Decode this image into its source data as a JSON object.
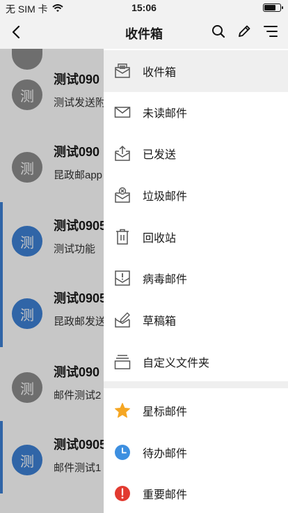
{
  "status_bar": {
    "carrier": "无 SIM 卡",
    "time": "15:06",
    "wifi_icon": "wifi-icon",
    "battery_icon": "battery-icon"
  },
  "nav": {
    "title": "收件箱",
    "back_icon": "chevron-left-icon",
    "search_icon": "search-icon",
    "compose_icon": "pencil-icon",
    "filter_icon": "filter-icon"
  },
  "mail_list": [
    {
      "sender": "测试090",
      "subject": "测试发送附",
      "avatar": "测",
      "unread": false,
      "avatar_color": "#8e8e8e"
    },
    {
      "sender": "测试090",
      "subject": "昆政邮app",
      "avatar": "测",
      "unread": false,
      "avatar_color": "#8e8e8e"
    },
    {
      "sender": "测试0905",
      "subject": "测试功能",
      "avatar": "测",
      "unread": true,
      "avatar_color": "#3e82d6"
    },
    {
      "sender": "测试0905",
      "subject": "昆政邮发送",
      "avatar": "测",
      "unread": true,
      "avatar_color": "#3e82d6"
    },
    {
      "sender": "测试090",
      "subject": "邮件测试2",
      "avatar": "测",
      "unread": false,
      "avatar_color": "#8e8e8e"
    },
    {
      "sender": "测试0905",
      "subject": "邮件测试1",
      "avatar": "测",
      "unread": true,
      "avatar_color": "#3e82d6"
    }
  ],
  "drawer": {
    "folders": [
      {
        "label": "收件箱",
        "icon": "inbox-icon",
        "active": true
      },
      {
        "label": "未读邮件",
        "icon": "envelope-icon",
        "active": false
      },
      {
        "label": "已发送",
        "icon": "sent-icon",
        "active": false
      },
      {
        "label": "垃圾邮件",
        "icon": "spam-icon",
        "active": false
      },
      {
        "label": "回收站",
        "icon": "trash-icon",
        "active": false
      },
      {
        "label": "病毒邮件",
        "icon": "virus-mail-icon",
        "active": false
      },
      {
        "label": "草稿箱",
        "icon": "draft-icon",
        "active": false
      },
      {
        "label": "自定义文件夹",
        "icon": "folder-icon",
        "active": false
      }
    ],
    "tags": [
      {
        "label": "星标邮件",
        "icon": "star-icon",
        "color": "#f5a623"
      },
      {
        "label": "待办邮件",
        "icon": "clock-icon",
        "color": "#3d8fe0"
      },
      {
        "label": "重要邮件",
        "icon": "important-icon",
        "color": "#e23a30"
      }
    ]
  },
  "colors": {
    "accent": "#3e82d6",
    "read_avatar": "#8e8e8e",
    "active_row": "#efefef"
  }
}
